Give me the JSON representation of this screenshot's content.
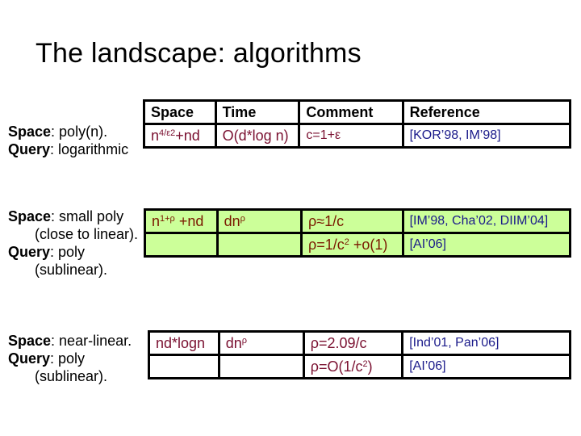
{
  "slide": {
    "title": "The landscape: algorithms"
  },
  "headers": [
    "Space",
    "Time",
    "Comment",
    "Reference"
  ],
  "sections": [
    {
      "description": [
        {
          "bold": "Space",
          "rest": ": poly(n)."
        },
        {
          "bold": "Query",
          "rest": ": logarithmic"
        }
      ],
      "rows": [
        {
          "space_base": "n",
          "space_sup": "4/ε2",
          "space_tail": "+nd",
          "time": "O(d*log n)",
          "comment": "c=1+ε",
          "reference": "[KOR’98, IM’98]"
        }
      ]
    },
    {
      "description": [
        {
          "bold": "Space",
          "rest": ": small poly"
        },
        {
          "bold": "",
          "rest": "(close to linear)."
        },
        {
          "bold": "Query",
          "rest": ": poly"
        },
        {
          "bold": "",
          "rest": "(sublinear)."
        }
      ],
      "rows": [
        {
          "space_base": "n",
          "space_sup": "1+ρ",
          "space_tail": " +nd",
          "time_base": "dn",
          "time_sup": "ρ",
          "comment": "ρ≈1/c",
          "reference": "[IM’98, Cha’02, DIIM’04]"
        },
        {
          "comment_base": "ρ=1/c",
          "comment_sup": "2",
          "comment_tail": " +o(1)",
          "reference": "[AI’06]"
        }
      ]
    },
    {
      "description": [
        {
          "bold": "Space",
          "rest": ": near-linear."
        },
        {
          "bold": "Query",
          "rest": ": poly"
        },
        {
          "bold": "",
          "rest": "(sublinear)."
        }
      ],
      "rows": [
        {
          "space": "nd*logn",
          "time_base": "dn",
          "time_sup": "ρ",
          "comment": "ρ=2.09/c",
          "reference": "[Ind’01, Pan’06]"
        },
        {
          "comment_base": "ρ=O(1/c",
          "comment_sup": "2",
          "comment_tail": ")",
          "reference": "[AI’06]"
        }
      ]
    }
  ]
}
